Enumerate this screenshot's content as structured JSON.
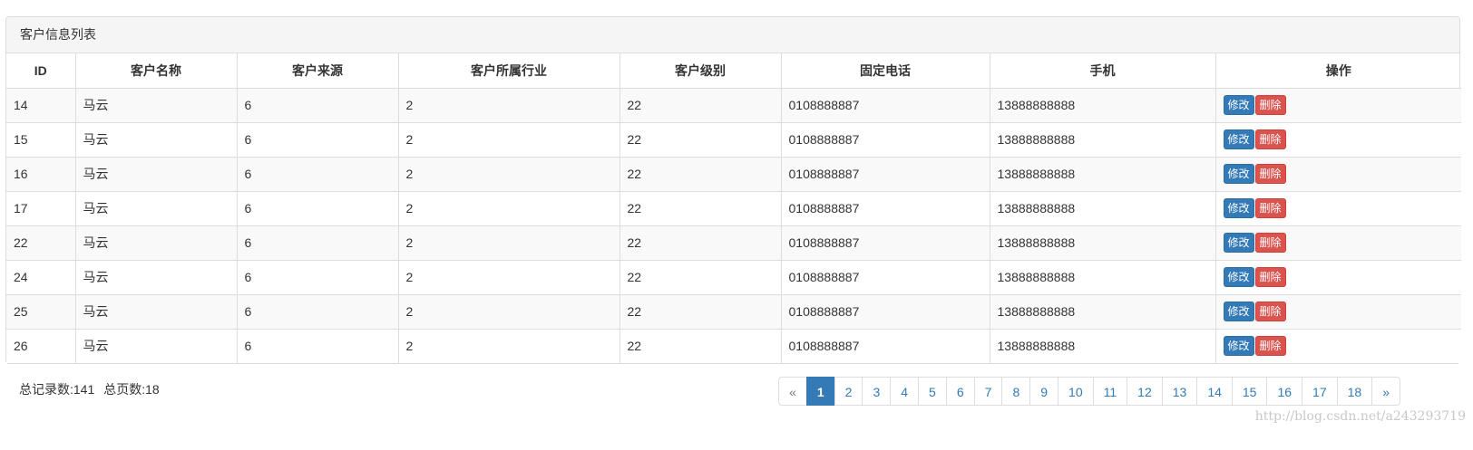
{
  "panel": {
    "title": "客户信息列表"
  },
  "table": {
    "columns": [
      "ID",
      "客户名称",
      "客户来源",
      "客户所属行业",
      "客户级别",
      "固定电话",
      "手机",
      "操作"
    ],
    "rows": [
      {
        "id": "14",
        "name": "马云",
        "source": "6",
        "industry": "2",
        "level": "22",
        "phone": "0108888887",
        "mobile": "13888888888"
      },
      {
        "id": "15",
        "name": "马云",
        "source": "6",
        "industry": "2",
        "level": "22",
        "phone": "0108888887",
        "mobile": "13888888888"
      },
      {
        "id": "16",
        "name": "马云",
        "source": "6",
        "industry": "2",
        "level": "22",
        "phone": "0108888887",
        "mobile": "13888888888"
      },
      {
        "id": "17",
        "name": "马云",
        "source": "6",
        "industry": "2",
        "level": "22",
        "phone": "0108888887",
        "mobile": "13888888888"
      },
      {
        "id": "22",
        "name": "马云",
        "source": "6",
        "industry": "2",
        "level": "22",
        "phone": "0108888887",
        "mobile": "13888888888"
      },
      {
        "id": "24",
        "name": "马云",
        "source": "6",
        "industry": "2",
        "level": "22",
        "phone": "0108888887",
        "mobile": "13888888888"
      },
      {
        "id": "25",
        "name": "马云",
        "source": "6",
        "industry": "2",
        "level": "22",
        "phone": "0108888887",
        "mobile": "13888888888"
      },
      {
        "id": "26",
        "name": "马云",
        "source": "6",
        "industry": "2",
        "level": "22",
        "phone": "0108888887",
        "mobile": "13888888888"
      }
    ],
    "edit_label": "修改",
    "delete_label": "删除"
  },
  "summary": {
    "total_records": "总记录数:141",
    "total_pages": "总页数:18"
  },
  "pagination": {
    "prev": "«",
    "pages": [
      "1",
      "2",
      "3",
      "4",
      "5",
      "6",
      "7",
      "8",
      "9",
      "10",
      "11",
      "12",
      "13",
      "14",
      "15",
      "16",
      "17",
      "18"
    ],
    "active": "1",
    "next": "»"
  },
  "watermark": "http://blog.csdn.net/a243293719",
  "colors": {
    "primary": "#337ab7",
    "danger": "#d9534f",
    "border": "#dddddd",
    "heading_bg": "#f5f5f5"
  }
}
